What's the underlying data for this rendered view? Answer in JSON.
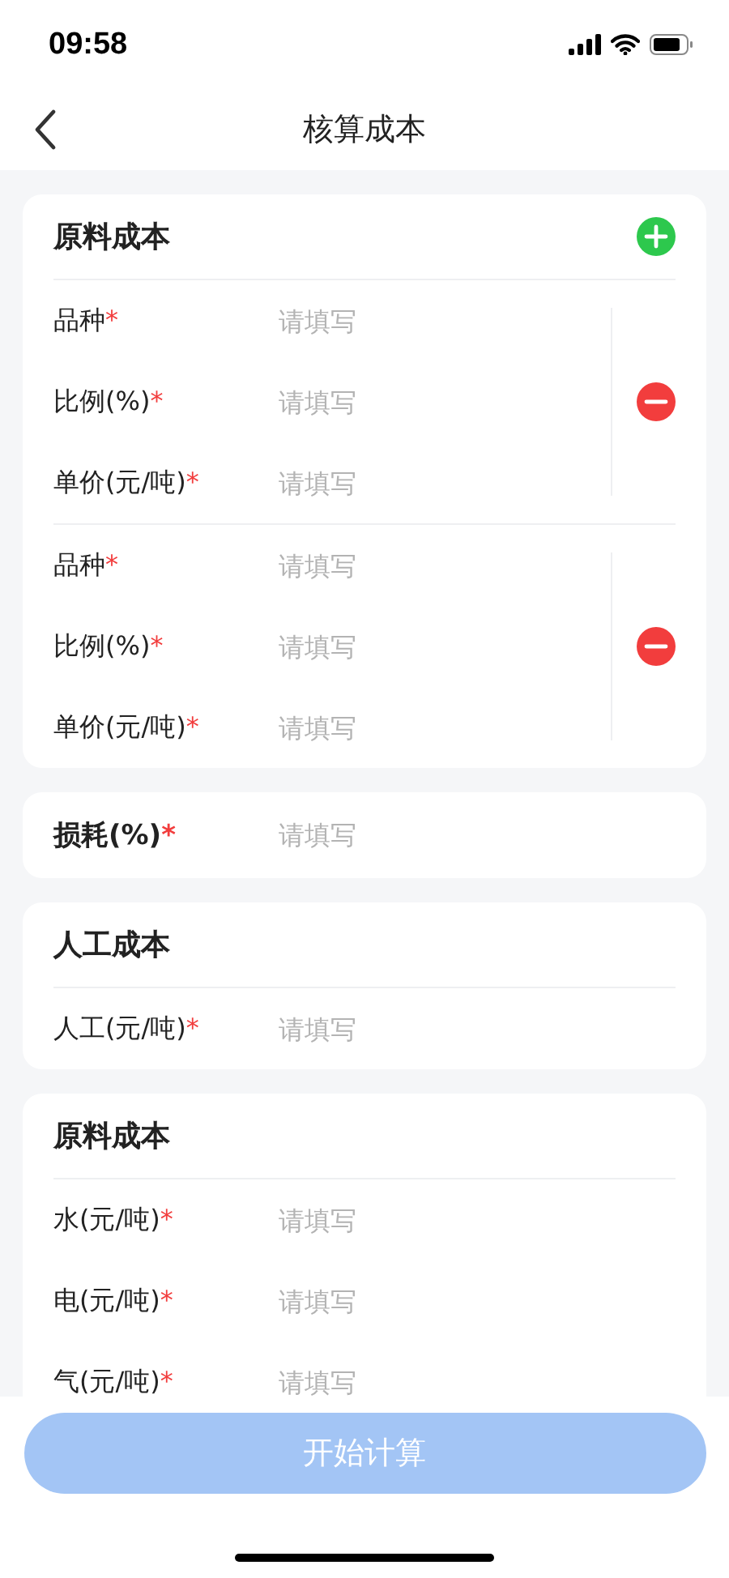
{
  "status_bar": {
    "time": "09:58"
  },
  "nav": {
    "title": "核算成本"
  },
  "sections": [
    {
      "kind": "material",
      "title": "原料成本",
      "groups": [
        {
          "fields": [
            {
              "label": "品种",
              "required_mark": "*",
              "placeholder": "请填写"
            },
            {
              "label": "比例(%)",
              "required_mark": "*",
              "placeholder": "请填写"
            },
            {
              "label": "单价(元/吨)",
              "required_mark": "*",
              "placeholder": "请填写"
            }
          ]
        },
        {
          "fields": [
            {
              "label": "品种",
              "required_mark": "*",
              "placeholder": "请填写"
            },
            {
              "label": "比例(%)",
              "required_mark": "*",
              "placeholder": "请填写"
            },
            {
              "label": "单价(元/吨)",
              "required_mark": "*",
              "placeholder": "请填写"
            }
          ]
        }
      ]
    },
    {
      "kind": "single",
      "fields": [
        {
          "label": "损耗(%)",
          "required_mark": "*",
          "placeholder": "请填写"
        }
      ]
    },
    {
      "kind": "group",
      "title": "人工成本",
      "fields": [
        {
          "label": "人工(元/吨)",
          "required_mark": "*",
          "placeholder": "请填写"
        }
      ]
    },
    {
      "kind": "group",
      "title": "原料成本",
      "fields": [
        {
          "label": "水(元/吨)",
          "required_mark": "*",
          "placeholder": "请填写"
        },
        {
          "label": "电(元/吨)",
          "required_mark": "*",
          "placeholder": "请填写"
        },
        {
          "label": "气(元/吨)",
          "required_mark": "*",
          "placeholder": "请填写"
        }
      ]
    }
  ],
  "footer": {
    "button": "开始计算",
    "disabled": true
  }
}
